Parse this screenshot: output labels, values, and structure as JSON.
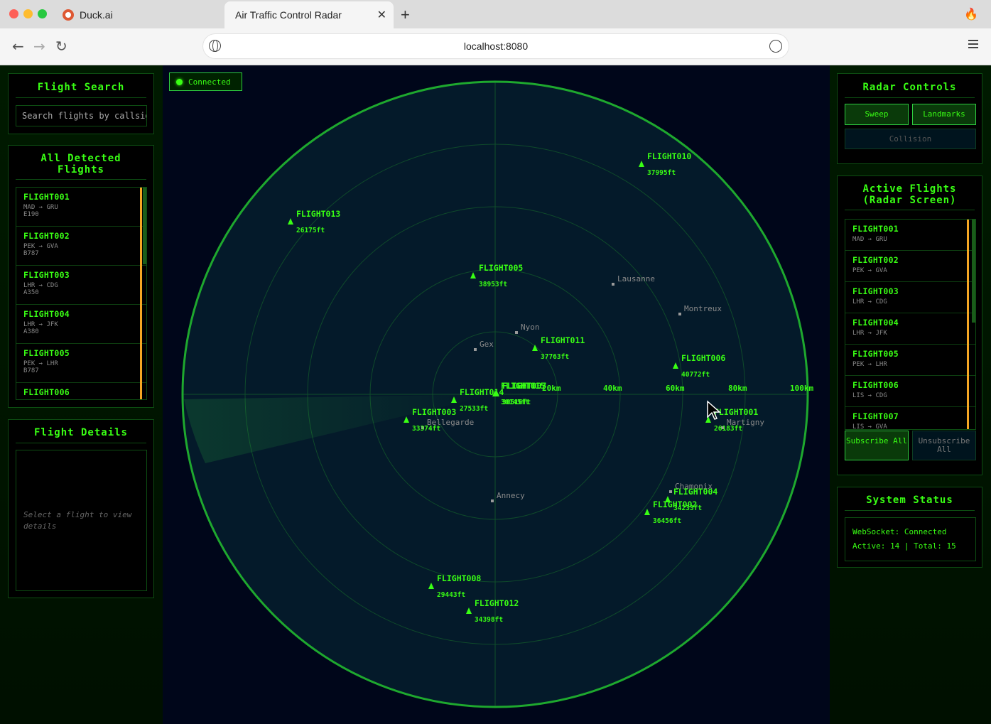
{
  "browser": {
    "tabs": [
      {
        "title": "Duck.ai"
      },
      {
        "title": "Air Traffic Control Radar"
      }
    ],
    "url": "localhost:8080"
  },
  "connection": {
    "label": "Connected"
  },
  "search": {
    "title": "Flight Search",
    "placeholder": "Search flights by callsign"
  },
  "detected": {
    "title": "All Detected Flights",
    "flights": [
      {
        "id": "FLIGHT001",
        "route": "MAD → GRU",
        "aircraft": "E190"
      },
      {
        "id": "FLIGHT002",
        "route": "PEK → GVA",
        "aircraft": "B787"
      },
      {
        "id": "FLIGHT003",
        "route": "LHR → CDG",
        "aircraft": "A350"
      },
      {
        "id": "FLIGHT004",
        "route": "LHR → JFK",
        "aircraft": "A380"
      },
      {
        "id": "FLIGHT005",
        "route": "PEK → LHR",
        "aircraft": "B787"
      },
      {
        "id": "FLIGHT006",
        "route": "",
        "aircraft": ""
      }
    ]
  },
  "details": {
    "title": "Flight Details",
    "placeholder": "Select a flight to view details"
  },
  "controls": {
    "title": "Radar Controls",
    "sweep": "Sweep",
    "landmarks": "Landmarks",
    "collision": "Collision"
  },
  "active": {
    "title": "Active Flights (Radar Screen)",
    "flights": [
      {
        "id": "FLIGHT001",
        "route": "MAD → GRU"
      },
      {
        "id": "FLIGHT002",
        "route": "PEK → GVA"
      },
      {
        "id": "FLIGHT003",
        "route": "LHR → CDG"
      },
      {
        "id": "FLIGHT004",
        "route": "LHR → JFK"
      },
      {
        "id": "FLIGHT005",
        "route": "PEK → LHR"
      },
      {
        "id": "FLIGHT006",
        "route": "LIS → CDG"
      },
      {
        "id": "FLIGHT007",
        "route": "LIS → GVA"
      }
    ],
    "subscribe_all": "Subscribe All",
    "unsubscribe_all": "Unsubscribe All"
  },
  "status": {
    "title": "System Status",
    "websocket": "WebSocket: Connected",
    "counts": "Active: 14 | Total: 15"
  },
  "radar": {
    "range_labels": [
      "20km",
      "40km",
      "60km",
      "80km",
      "100km"
    ],
    "landmarks": [
      "Lausanne",
      "Montreux",
      "Nyon",
      "Gex",
      "Bellegarde",
      "Annecy",
      "Martigny",
      "Chamonix"
    ],
    "flights": [
      {
        "id": "FLIGHT010",
        "altitude": "37995ft"
      },
      {
        "id": "FLIGHT013",
        "altitude": "26175ft"
      },
      {
        "id": "FLIGHT005",
        "altitude": "38953ft"
      },
      {
        "id": "FLIGHT011",
        "altitude": "37763ft"
      },
      {
        "id": "FLIGHT006",
        "altitude": "40772ft"
      },
      {
        "id": "FLIGHT015",
        "altitude": "30145ft"
      },
      {
        "id": "FLIGHT007",
        "altitude": "30516ft"
      },
      {
        "id": "FLIGHT014",
        "altitude": "27533ft"
      },
      {
        "id": "FLIGHT003",
        "altitude": "33374ft"
      },
      {
        "id": "FLIGHT001",
        "altitude": "26183ft"
      },
      {
        "id": "FLIGHT004",
        "altitude": "34233ft"
      },
      {
        "id": "FLIGHT002",
        "altitude": "36456ft"
      },
      {
        "id": "FLIGHT008",
        "altitude": "29443ft"
      },
      {
        "id": "FLIGHT012",
        "altitude": "34398ft"
      }
    ]
  }
}
